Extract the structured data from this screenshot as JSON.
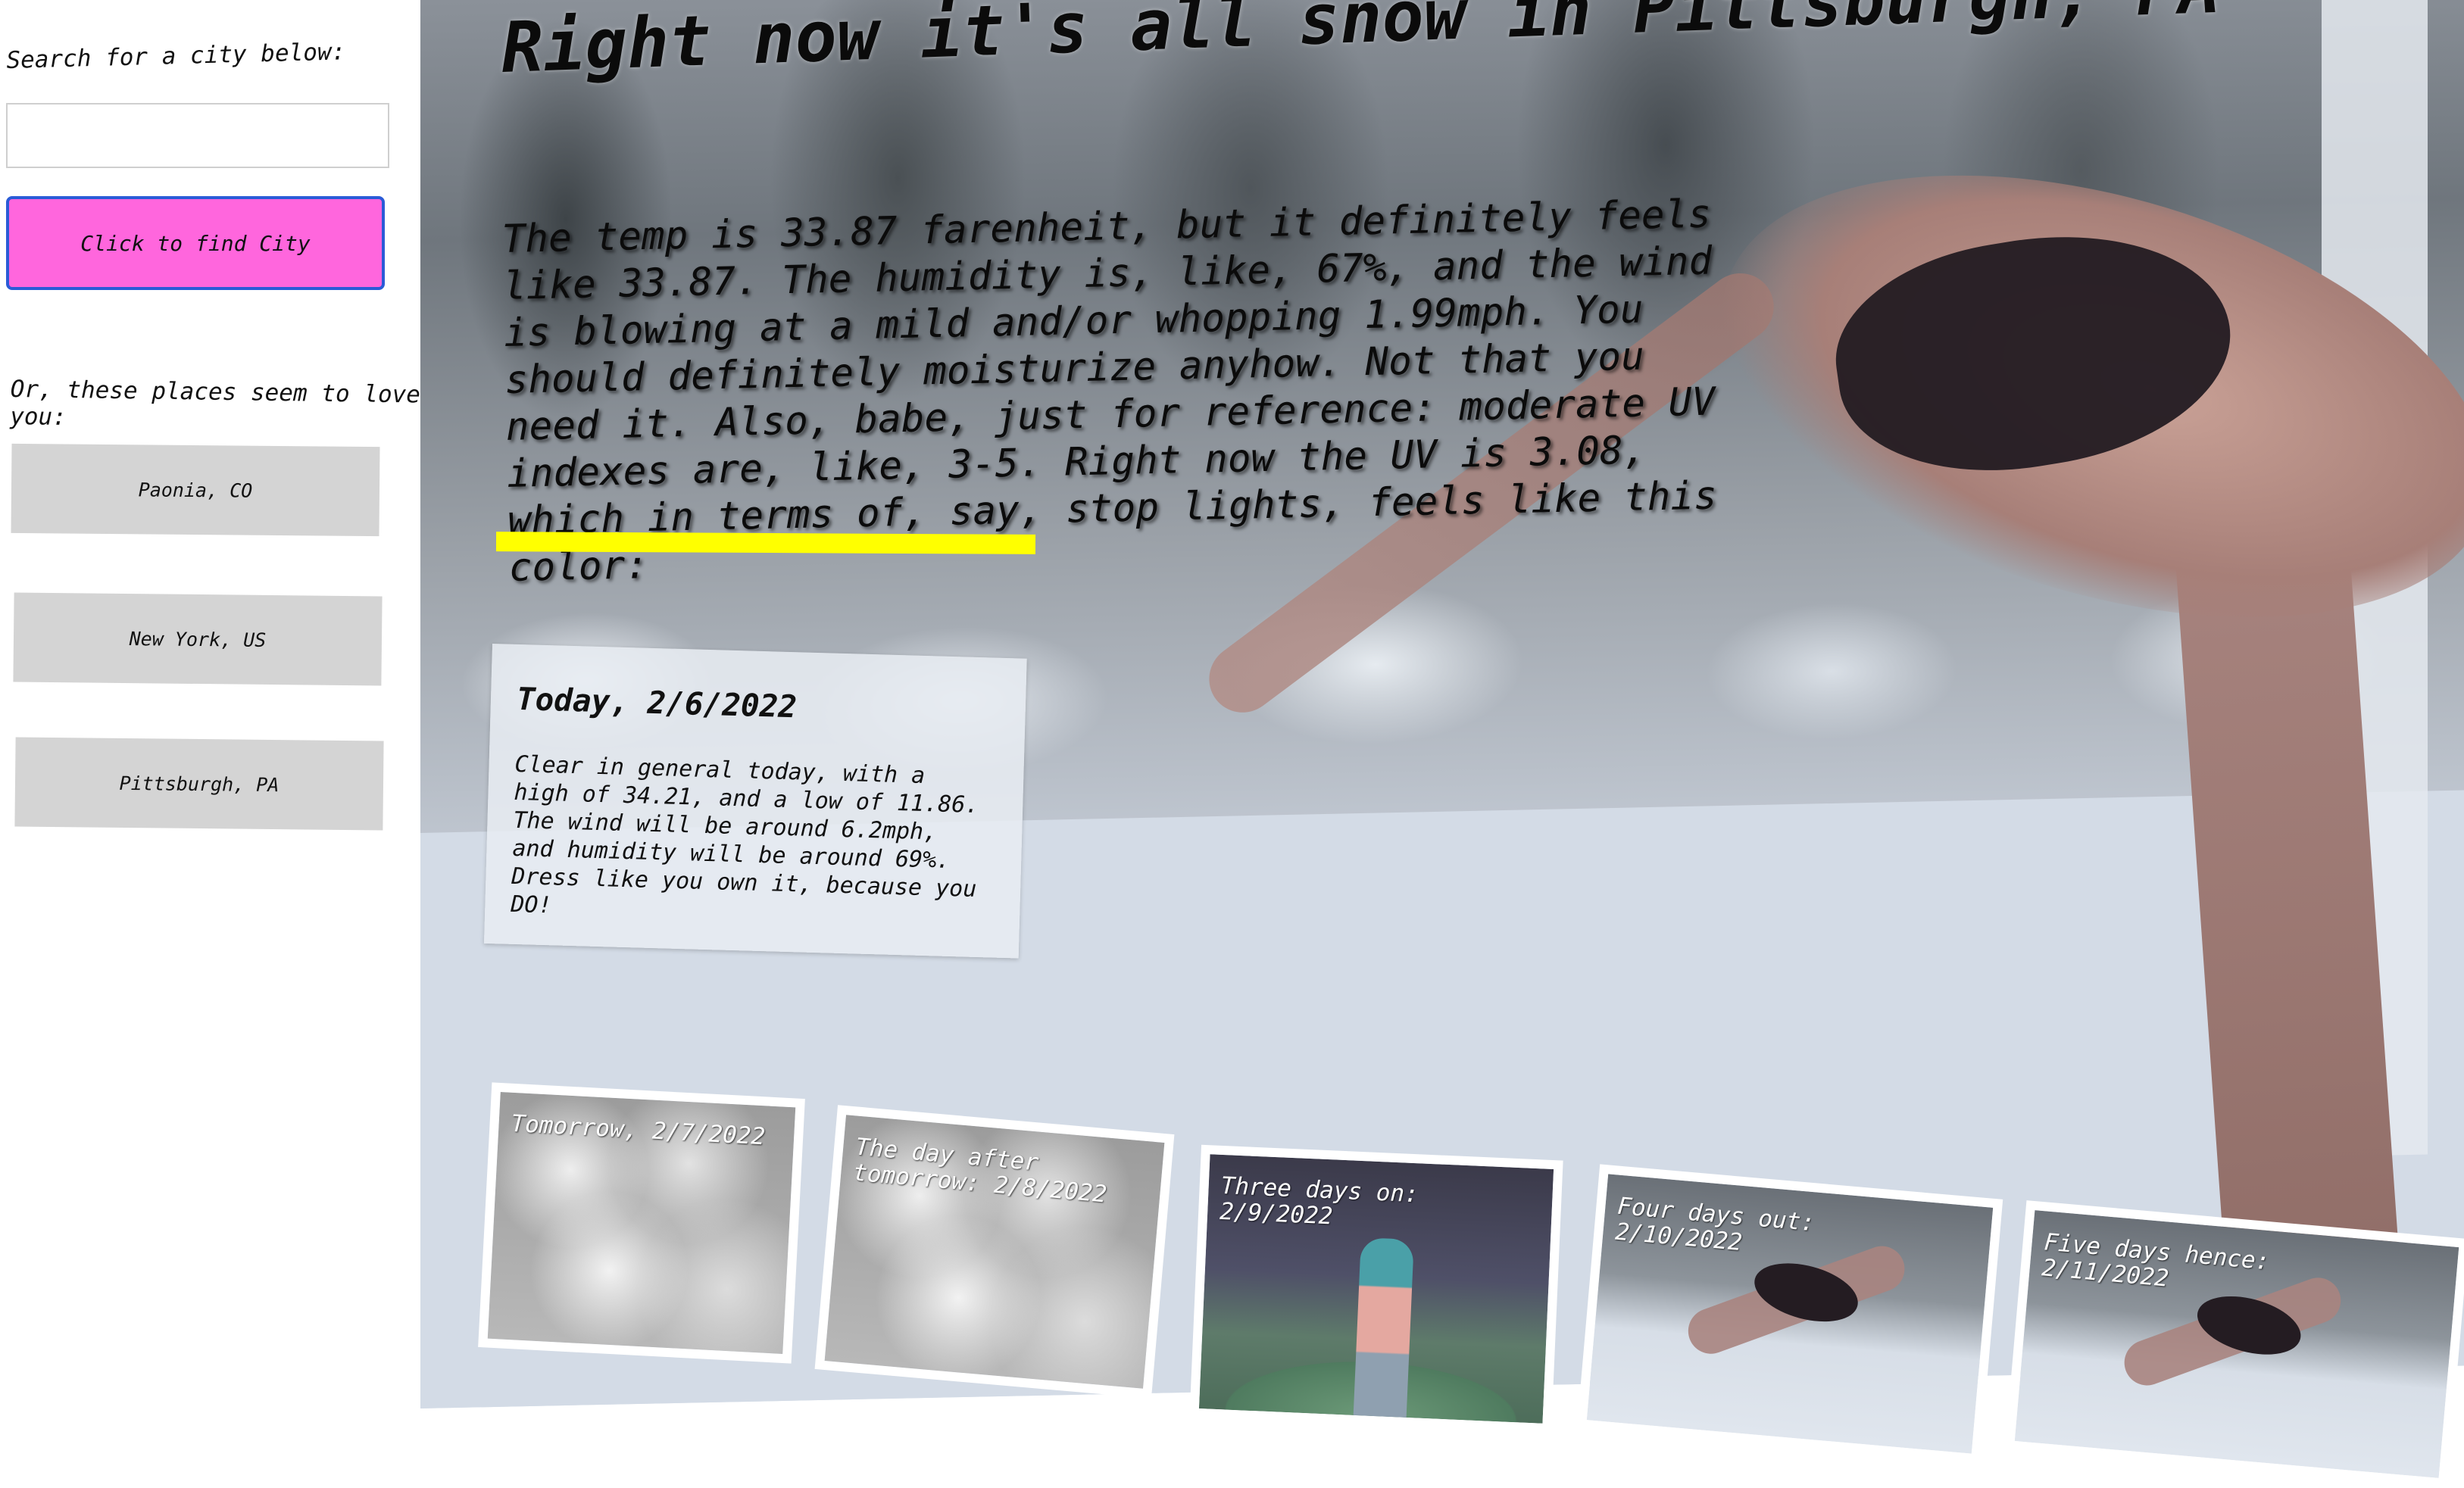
{
  "sidebar": {
    "search_label": "Search for a city below:",
    "search_placeholder": "",
    "search_value": "",
    "find_button": "Click to find City",
    "love_label": "Or, these places seem to love you:",
    "cities": [
      "Paonia, CO",
      "New York, US",
      "Pittsburgh, PA"
    ]
  },
  "main": {
    "headline": "Right now it's all snow in Pittsburgh, PA",
    "info": "The temp is 33.87 farenheit, but it definitely feels like 33.87. The humidity is, like, 67%, and the wind is blowing at a mild and/or whopping 1.99mph. You should definitely moisturize anyhow. Not that you need it. Also, babe, just for reference: moderate UV indexes are, like, 3-5. Right now the UV is 3.08, which in terms of, say, stop lights, feels like this color:",
    "uv_color": "#ffff00"
  },
  "today": {
    "title": "Today, 2/6/2022",
    "text": "Clear in general today, with a high of 34.21, and a low of 11.86. The wind will be around 6.2mph, and humidity will be around 69%. Dress like you own it, because you DO!"
  },
  "forecast": [
    {
      "label": "Tomorrow, 2/7/2022",
      "image": "clouds"
    },
    {
      "label": "The day after tomorrow: 2/8/2022",
      "image": "clouds"
    },
    {
      "label": "Three days on: 2/9/2022",
      "image": "cartoon-rain"
    },
    {
      "label": "Four days out: 2/10/2022",
      "image": "snow-dive"
    },
    {
      "label": "Five days hence: 2/11/2022",
      "image": "snow-dive"
    }
  ],
  "colors": {
    "find_button_bg": "#ff66dd",
    "find_button_border": "#2a5bd7",
    "city_button_bg": "#d4d4d4"
  }
}
